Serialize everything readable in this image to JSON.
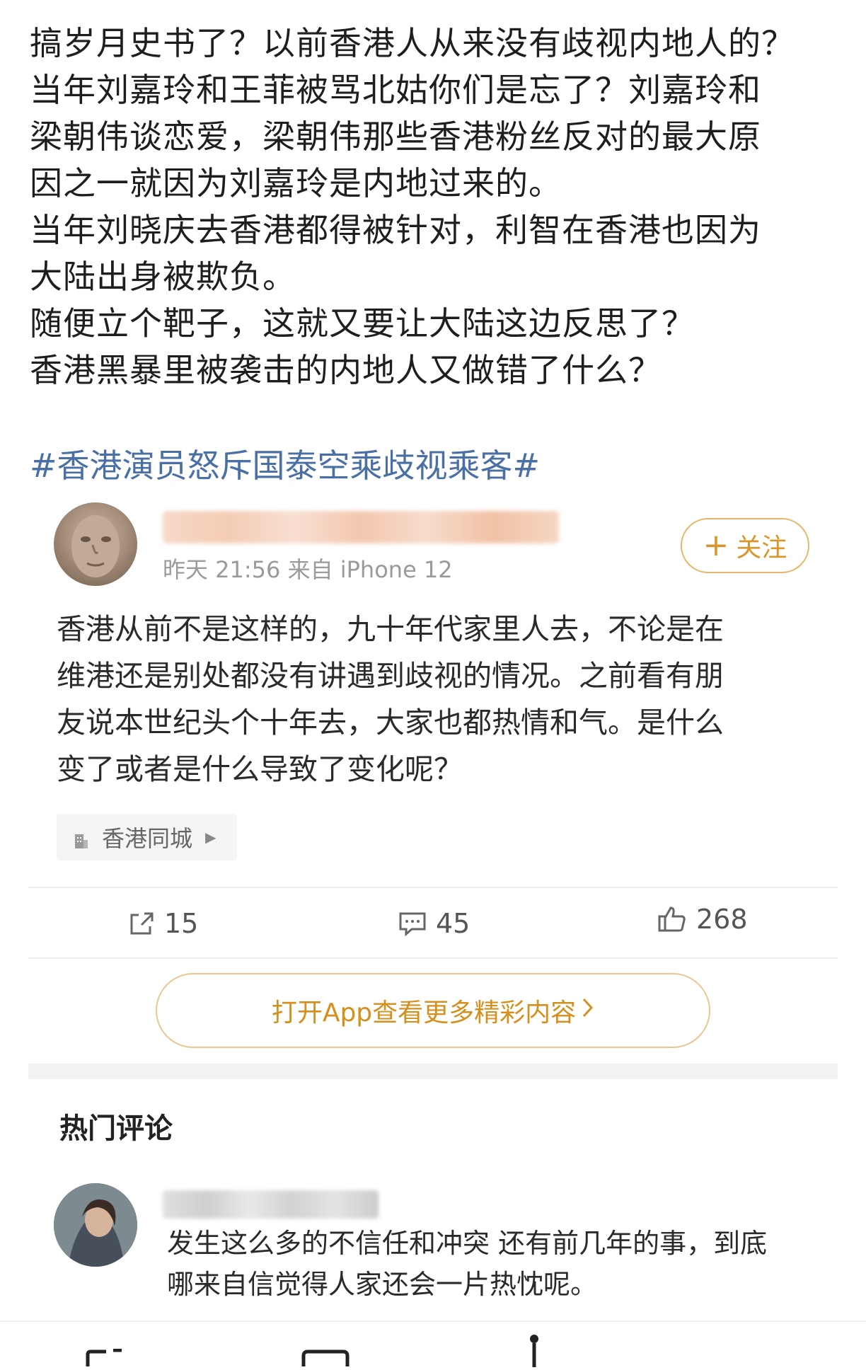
{
  "post": {
    "lines": [
      "搞岁月史书了？以前香港人从来没有歧视内地人的？",
      "当年刘嘉玲和王菲被骂北姑你们是忘了？刘嘉玲和",
      "梁朝伟谈恋爱，梁朝伟那些香港粉丝反对的最大原",
      "因之一就因为刘嘉玲是内地过来的。",
      "当年刘晓庆去香港都得被针对，利智在香港也因为",
      "大陆出身被欺负。",
      "随便立个靶子，这就又要让大陆这边反思了？",
      "香港黑暴里被袭击的内地人又做错了什么？"
    ],
    "hashtag": "#香港演员怒斥国泰空乘歧视乘客#"
  },
  "repost": {
    "meta": "昨天 21:56 来自 iPhone 12",
    "follow_label": "关注",
    "lines": [
      "香港从前不是这样的，九十年代家里人去，不论是在",
      "维港还是别处都没有讲遇到歧视的情况。之前看有朋",
      "友说本世纪头个十年去，大家也都热情和气。是什么",
      "变了或者是什么导致了变化呢？"
    ],
    "location": "香港同城",
    "reposts": "15",
    "comments": "45",
    "likes": "268"
  },
  "open_app_label": "打开App查看更多精彩内容",
  "hot_comments": {
    "title": "热门评论",
    "items": [
      {
        "lines": [
          "发生这么多的不信任和冲突 还有前几年的事，到底",
          "哪来自信觉得人家还会一片热忱呢。"
        ]
      }
    ]
  },
  "colors": {
    "hashtag": "#4a6fa5",
    "accent": "#d9962a",
    "text": "#1e1e1e",
    "meta": "#9a9a9a"
  }
}
